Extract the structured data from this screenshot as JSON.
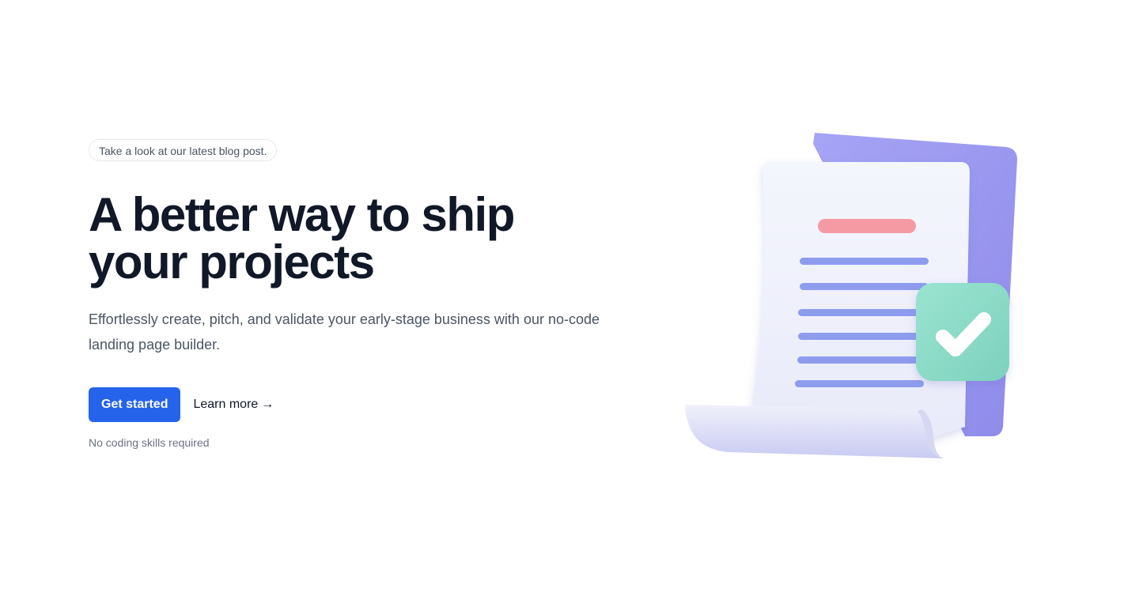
{
  "hero": {
    "blog_pill": "Take a look at our latest blog post.",
    "headline": "A better way to ship your projects",
    "subtext": "Effortlessly create, pitch, and validate your early-stage business with our no-code landing page builder.",
    "primary_cta": "Get started",
    "secondary_cta": "Learn more",
    "secondary_arrow": "→",
    "note": "No coding skills required"
  },
  "colors": {
    "primary": "#2563eb",
    "heading": "#111827",
    "body": "#4b5563",
    "muted": "#6b7280",
    "purple_paper": "#9a97f0",
    "check_green": "#8fdcc9",
    "red_bar": "#f59aa3",
    "line_blue": "#8e9cee"
  },
  "icons": {
    "arrow": "arrow-right-icon",
    "check": "checkmark-icon",
    "document": "document-illustration"
  }
}
